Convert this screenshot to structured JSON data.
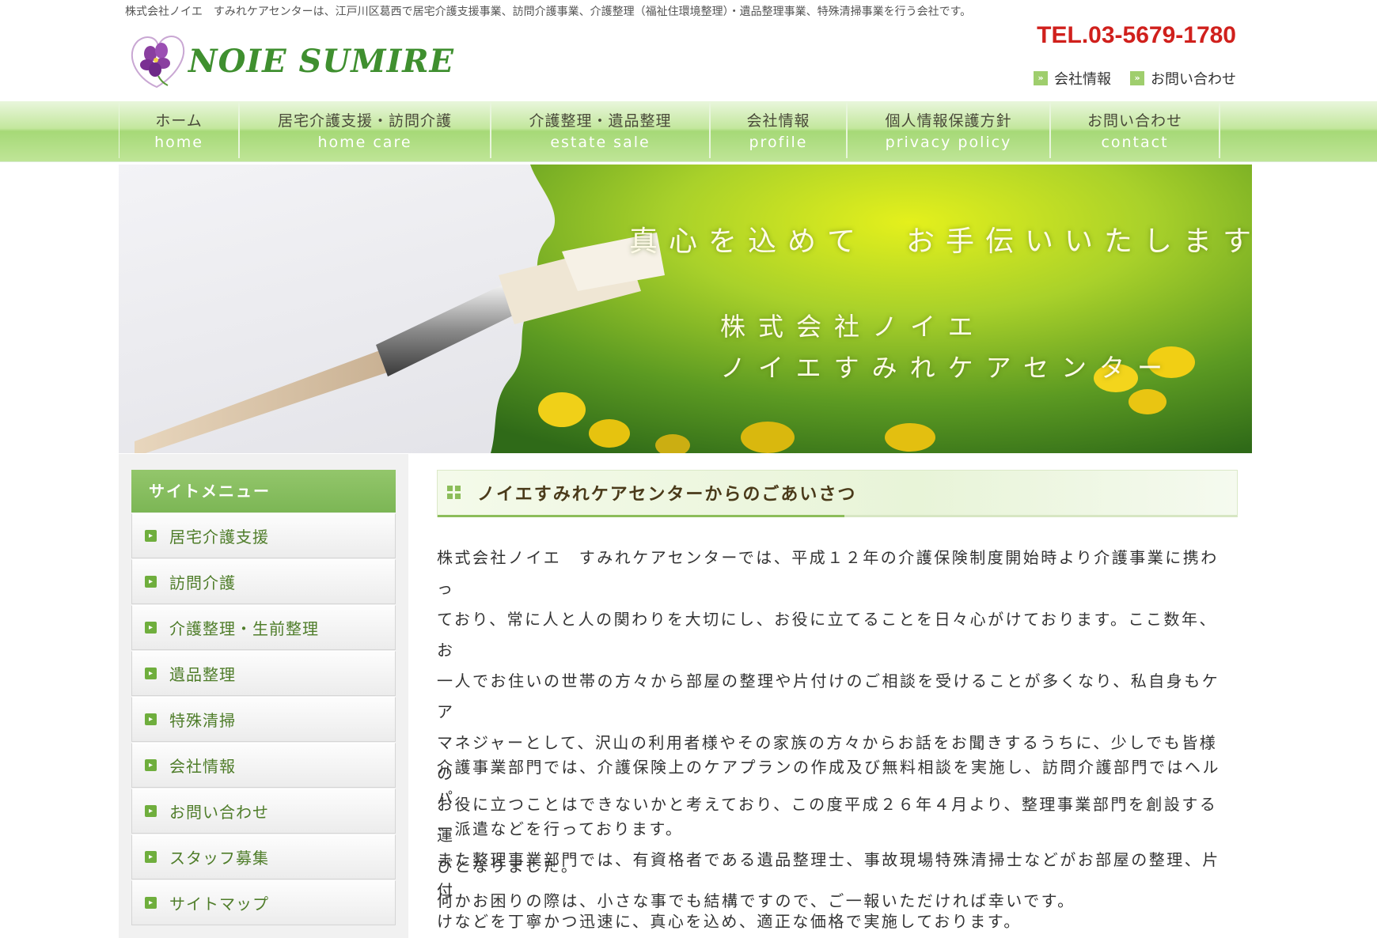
{
  "header": {
    "tagline": "株式会社ノイエ　すみれケアセンターは、江戸川区葛西で居宅介護支援事業、訪問介護事業、介護整理（福祉住環境整理）・遺品整理事業、特殊清掃事業を行う会社です。",
    "logo_text": "NOIE SUMIRE",
    "tel": "TEL.03-5679-1780",
    "links": [
      {
        "label": "会社情報"
      },
      {
        "label": "お問い合わせ"
      }
    ]
  },
  "nav": [
    {
      "jp": "ホーム",
      "en": "home"
    },
    {
      "jp": "居宅介護支援・訪問介護",
      "en": "home care"
    },
    {
      "jp": "介護整理・遺品整理",
      "en": "estate sale"
    },
    {
      "jp": "会社情報",
      "en": "profile"
    },
    {
      "jp": "個人情報保護方針",
      "en": "privacy policy"
    },
    {
      "jp": "お問い合わせ",
      "en": "contact"
    }
  ],
  "hero": {
    "line1": "真心を込めて　お手伝いいたします",
    "line2": "株式会社ノイエ",
    "line3": "ノイエすみれケアセンター"
  },
  "sidebar": {
    "title": "サイトメニュー",
    "items": [
      {
        "label": "居宅介護支援"
      },
      {
        "label": "訪問介護"
      },
      {
        "label": "介護整理・生前整理"
      },
      {
        "label": "遺品整理"
      },
      {
        "label": "特殊清掃"
      },
      {
        "label": "会社情報"
      },
      {
        "label": "お問い合わせ"
      },
      {
        "label": "スタッフ募集"
      },
      {
        "label": "サイトマップ"
      }
    ]
  },
  "main": {
    "title": "ノイエすみれケアセンターからのごあいさつ",
    "paragraphs": [
      [
        "株式会社ノイエ　すみれケアセンターでは、平成１２年の介護保険制度開始時より介護事業に携わっ",
        "ており、常に人と人の関わりを大切にし、お役に立てることを日々心がけております。ここ数年、お",
        "一人でお住いの世帯の方々から部屋の整理や片付けのご相談を受けることが多くなり、私自身もケア",
        "マネジャーとして、沢山の利用者様やその家族の方々からお話をお聞きするうちに、少しでも皆様の",
        "お役に立つことはできないかと考えており、この度平成２６年４月より、整理事業部門を創設する運",
        "びとなりました。"
      ],
      [
        "介護事業部門では、介護保険上のケアプランの作成及び無料相談を実施し、訪問介護部門ではヘルパ",
        "ー派遣などを行っております。",
        "また整理事業部門では、有資格者である遺品整理士、事故現場特殊清掃士などがお部屋の整理、片付",
        "けなどを丁寧かつ迅速に、真心を込め、適正な価格で実施しております。"
      ],
      [
        "何かお困りの際は、小さな事でも結構ですので、ご一報いただければ幸いです。"
      ]
    ]
  },
  "colors": {
    "accent_green": "#8cbd5a",
    "tel_red": "#d0201c",
    "sidebar_text": "#4f7d2a"
  },
  "icons": [
    "violet-flower-logo-icon",
    "double-chevron-right-icon",
    "arrow-right-icon",
    "grid-squares-icon"
  ]
}
